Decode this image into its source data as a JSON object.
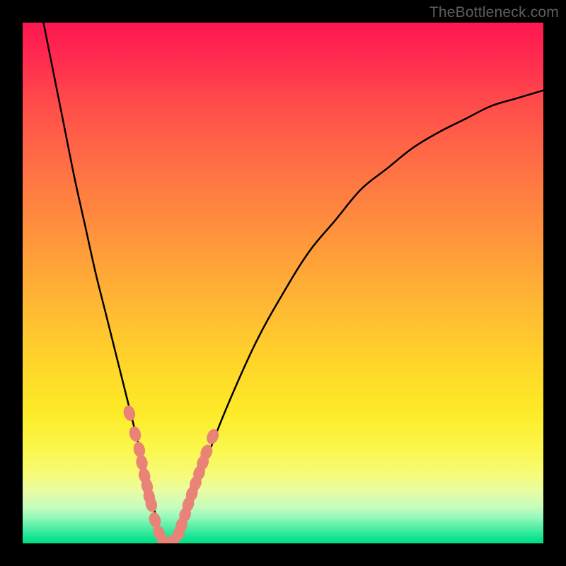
{
  "watermark": "TheBottleneck.com",
  "chart_data": {
    "type": "line",
    "title": "",
    "xlabel": "",
    "ylabel": "",
    "xlim": [
      0,
      100
    ],
    "ylim": [
      0,
      100
    ],
    "grid": false,
    "series": [
      {
        "name": "curve",
        "color": "#000000",
        "x": [
          4,
          6,
          8,
          10,
          12,
          14,
          16,
          18,
          20,
          22,
          23.5,
          25,
          26,
          27,
          28.5,
          30,
          33,
          36,
          40,
          45,
          50,
          55,
          60,
          65,
          70,
          75,
          80,
          85,
          90,
          95,
          100
        ],
        "y": [
          100,
          90,
          80,
          70,
          61,
          52,
          44,
          36,
          28,
          20,
          14,
          8,
          3,
          0,
          0,
          2,
          9,
          18,
          28,
          39,
          48,
          56,
          62,
          68,
          72,
          76,
          79,
          81.5,
          84,
          85.5,
          87
        ]
      },
      {
        "name": "markers-left",
        "color": "#e98277",
        "x": [
          20.5,
          21.6,
          22.4,
          22.9,
          23.4,
          23.9,
          24.3,
          24.7,
          25.4,
          26.2,
          27.0
        ],
        "y": [
          25,
          21,
          18,
          15.5,
          13,
          11,
          9,
          7.5,
          4.5,
          2,
          0.5
        ]
      },
      {
        "name": "markers-bottom",
        "color": "#e98277",
        "x": [
          27.3,
          28.0,
          28.8
        ],
        "y": [
          0,
          0,
          0.5
        ]
      },
      {
        "name": "markers-right",
        "color": "#e98277",
        "x": [
          30.0,
          30.5,
          31.2,
          31.8,
          32.5,
          33.2,
          33.9,
          34.6,
          35.3,
          36.5
        ],
        "y": [
          2,
          3.5,
          5.5,
          7.5,
          9.5,
          11.5,
          13.5,
          15.5,
          17.5,
          20.5
        ]
      }
    ],
    "annotations": []
  }
}
